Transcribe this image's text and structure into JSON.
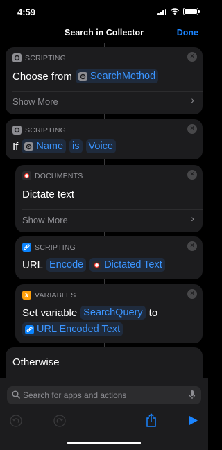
{
  "status_bar": {
    "time": "4:59"
  },
  "nav": {
    "title": "Search in Collector",
    "done_label": "Done"
  },
  "actions": {
    "choose": {
      "category": "SCRIPTING",
      "verb": "Choose from",
      "token": "SearchMethod",
      "show_more": "Show More"
    },
    "if": {
      "category": "SCRIPTING",
      "verb": "If",
      "token_subject": "Name",
      "operator": "is",
      "value": "Voice"
    },
    "dictate": {
      "category": "DOCUMENTS",
      "text": "Dictate text",
      "show_more": "Show More"
    },
    "url": {
      "category": "SCRIPTING",
      "verb": "URL",
      "token_action": "Encode",
      "token_input": "Dictated Text"
    },
    "set_variable": {
      "category": "VARIABLES",
      "verb": "Set variable",
      "variable": "SearchQuery",
      "connector": "to",
      "token_value": "URL Encoded Text"
    },
    "otherwise": {
      "label": "Otherwise"
    }
  },
  "bottom": {
    "search_placeholder": "Search for apps and actions"
  },
  "colors": {
    "accent": "#1a84ff",
    "card_background": "#1c1c1e",
    "variables_icon": "#ff9f0a",
    "url_icon": "#0a84ff"
  },
  "icons": {
    "scripting": "gear-icon",
    "documents": "microphone-dot-icon",
    "url": "link-icon",
    "variables": "x-variable-icon"
  }
}
